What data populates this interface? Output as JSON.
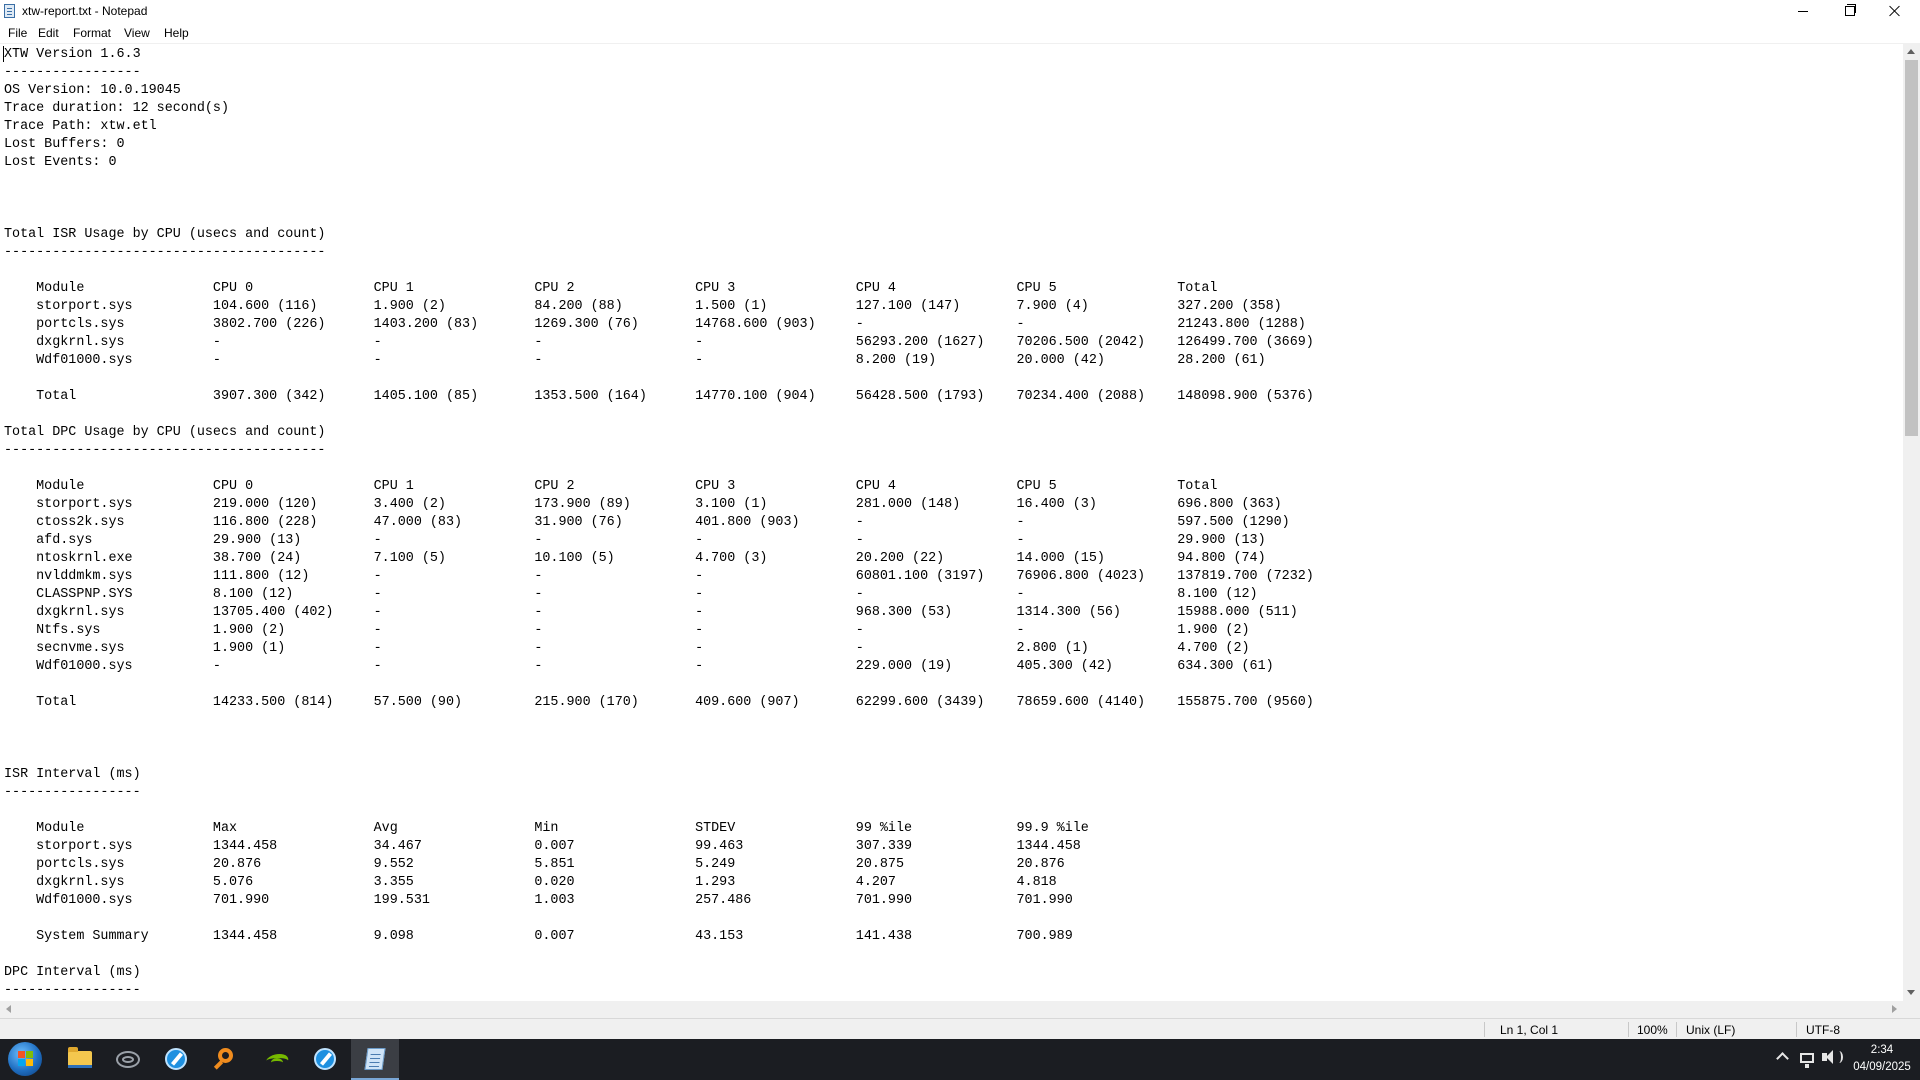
{
  "window": {
    "title": "xtw-report.txt - Notepad",
    "icon": "notepad-icon"
  },
  "menu": {
    "items": [
      "File",
      "Edit",
      "Format",
      "View",
      "Help"
    ]
  },
  "document": {
    "text": "XTW Version 1.6.3\n-----------------\nOS Version: 10.0.19045\nTrace duration: 12 second(s)\nTrace Path: xtw.etl\nLost Buffers: 0\nLost Events: 0\n\n\n\nTotal ISR Usage by CPU (usecs and count)\n----------------------------------------\n\n    Module                CPU 0               CPU 1               CPU 2               CPU 3               CPU 4               CPU 5               Total\n    storport.sys          104.600 (116)       1.900 (2)           84.200 (88)         1.500 (1)           127.100 (147)       7.900 (4)           327.200 (358)\n    portcls.sys           3802.700 (226)      1403.200 (83)       1269.300 (76)       14768.600 (903)     -                   -                   21243.800 (1288)\n    dxgkrnl.sys           -                   -                   -                   -                   56293.200 (1627)    70206.500 (2042)    126499.700 (3669)\n    Wdf01000.sys          -                   -                   -                   -                   8.200 (19)          20.000 (42)         28.200 (61)\n\n    Total                 3907.300 (342)      1405.100 (85)       1353.500 (164)      14770.100 (904)     56428.500 (1793)    70234.400 (2088)    148098.900 (5376)\n\nTotal DPC Usage by CPU (usecs and count)\n----------------------------------------\n\n    Module                CPU 0               CPU 1               CPU 2               CPU 3               CPU 4               CPU 5               Total\n    storport.sys          219.000 (120)       3.400 (2)           173.900 (89)        3.100 (1)           281.000 (148)       16.400 (3)          696.800 (363)\n    ctoss2k.sys           116.800 (228)       47.000 (83)         31.900 (76)         401.800 (903)       -                   -                   597.500 (1290)\n    afd.sys               29.900 (13)         -                   -                   -                   -                   -                   29.900 (13)\n    ntoskrnl.exe          38.700 (24)         7.100 (5)           10.100 (5)          4.700 (3)           20.200 (22)         14.000 (15)         94.800 (74)\n    nvlddmkm.sys          111.800 (12)        -                   -                   -                   60801.100 (3197)    76906.800 (4023)    137819.700 (7232)\n    CLASSPNP.SYS          8.100 (12)          -                   -                   -                   -                   -                   8.100 (12)\n    dxgkrnl.sys           13705.400 (402)     -                   -                   -                   968.300 (53)        1314.300 (56)       15988.000 (511)\n    Ntfs.sys              1.900 (2)           -                   -                   -                   -                   -                   1.900 (2)\n    secnvme.sys           1.900 (1)           -                   -                   -                   -                   2.800 (1)           4.700 (2)\n    Wdf01000.sys          -                   -                   -                   -                   229.000 (19)        405.300 (42)        634.300 (61)\n\n    Total                 14233.500 (814)     57.500 (90)         215.900 (170)       409.600 (907)       62299.600 (3439)    78659.600 (4140)    155875.700 (9560)\n\n\n\nISR Interval (ms)\n-----------------\n\n    Module                Max                 Avg                 Min                 STDEV               99 %ile             99.9 %ile\n    storport.sys          1344.458            34.467              0.007               99.463              307.339             1344.458\n    portcls.sys           20.876              9.552               5.851               5.249               20.875              20.876\n    dxgkrnl.sys           5.076               3.355               0.020               1.293               4.207               4.818\n    Wdf01000.sys          701.990             199.531             1.003               257.486             701.990             701.990\n\n    System Summary        1344.458            9.098               0.007               43.153              141.438             700.989\n\nDPC Interval (ms)\n-----------------"
  },
  "status_bar": {
    "position": "Ln 1, Col 1",
    "zoom": "100%",
    "line_ending": "Unix (LF)",
    "encoding": "UTF-8"
  },
  "taskbar": {
    "apps": [
      "start-icon",
      "file-explorer-icon",
      "audio-wave-icon",
      "browser-icon",
      "search-tool-icon",
      "nvidia-icon",
      "browser-icon",
      "notepad-icon"
    ],
    "clock": {
      "time": "2:34",
      "date": "04/09/2025"
    }
  }
}
